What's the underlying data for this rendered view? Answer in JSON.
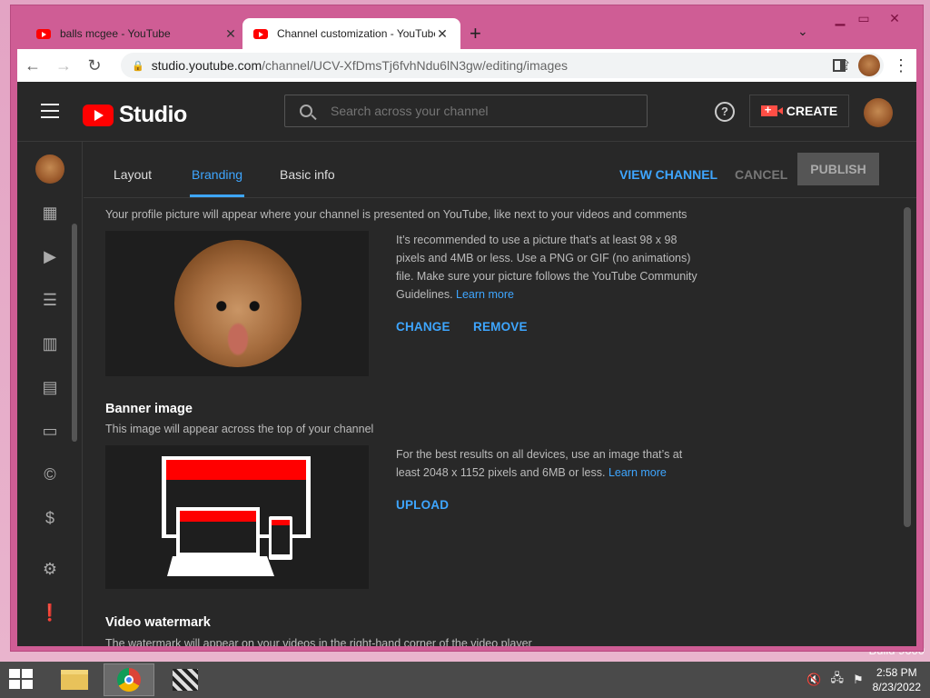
{
  "browser": {
    "tabs": [
      {
        "title": "balls mcgee - YouTube",
        "active": false
      },
      {
        "title": "Channel customization - YouTube",
        "active": true
      }
    ],
    "new_tab_symbol": "+",
    "url_host": "studio.youtube.com",
    "url_path": "/channel/UCV-XfDmsTj6fvhNdu6lN3gw/editing/images"
  },
  "studio": {
    "logo_text": "Studio",
    "search_placeholder": "Search across your channel",
    "create_label": "CREATE",
    "help_glyph": "?",
    "tabs": [
      {
        "label": "Layout",
        "active": false
      },
      {
        "label": "Branding",
        "active": true
      },
      {
        "label": "Basic info",
        "active": false
      }
    ],
    "view_channel_label": "VIEW CHANNEL",
    "cancel_label": "CANCEL",
    "publish_label": "PUBLISH",
    "sidebar_icons": [
      "dashboard-icon",
      "content-icon",
      "playlists-icon",
      "analytics-icon",
      "comments-icon",
      "subtitles-icon",
      "copyright-icon",
      "monetization-icon",
      "settings-icon",
      "feedback-icon"
    ]
  },
  "profile_picture": {
    "description": "Your profile picture will appear where your channel is presented on YouTube, like next to your videos and comments",
    "recommendation": "It’s recommended to use a picture that’s at least 98 x 98 pixels and 4MB or less. Use a PNG or GIF (no animations) file. Make sure your picture follows the YouTube Community Guidelines.",
    "learn_more": "Learn more",
    "change_label": "CHANGE",
    "remove_label": "REMOVE"
  },
  "banner_image": {
    "title": "Banner image",
    "description": "This image will appear across the top of your channel",
    "recommendation": "For the best results on all devices, use an image that’s at least 2048 x 1152 pixels and 6MB or less.",
    "learn_more": "Learn more",
    "upload_label": "UPLOAD"
  },
  "video_watermark": {
    "title": "Video watermark",
    "description": "The watermark will appear on your videos in the right-hand corner of the video player"
  },
  "taskbar": {
    "time": "2:58 PM",
    "date": "8/23/2022",
    "desktop_text": "Build 9600"
  },
  "colors": {
    "accent_blue": "#3ea6ff",
    "youtube_red": "#ff0000",
    "page_bg": "#282828"
  }
}
